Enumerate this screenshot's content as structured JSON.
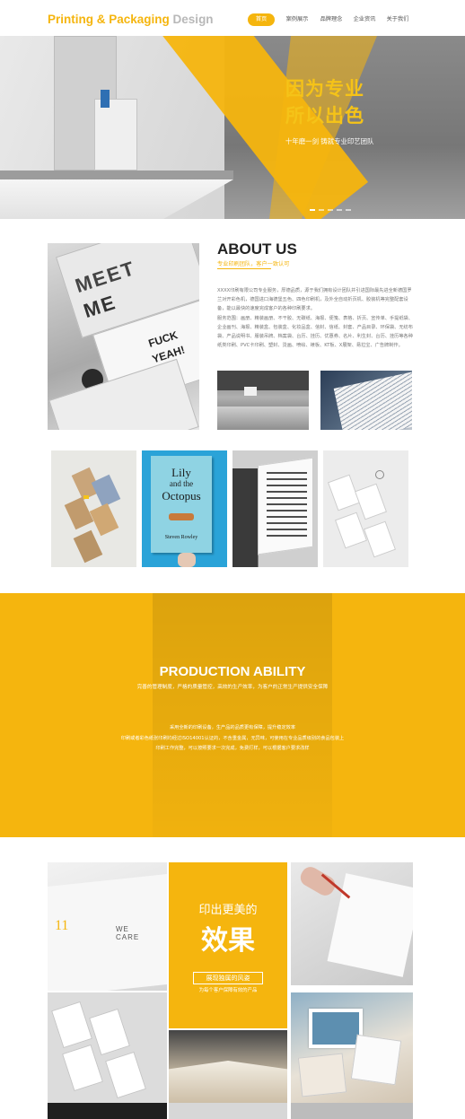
{
  "brand": {
    "part1": "Printing & Packaging",
    "part2": "Design",
    "accent": "#f5b50e",
    "muted": "#b8b8b8"
  },
  "nav": {
    "items": [
      {
        "label": "首页",
        "active": true
      },
      {
        "label": "案例展示",
        "active": false
      },
      {
        "label": "品牌理念",
        "active": false
      },
      {
        "label": "企业资讯",
        "active": false
      },
      {
        "label": "关于我们",
        "active": false
      }
    ]
  },
  "hero": {
    "title_line1": "因为专业",
    "title_line2": "所以出色",
    "subtitle": "十年磨一剑 铸就专业印艺团队"
  },
  "about": {
    "title": "ABOUT US",
    "subtitle": "专业印刷团队，客户一致认可",
    "paragraph1": "XXXX印刷有限公司专业服务，厚德品质，源于我们拥有设计团队并引进国际最先进全新德国罗兰对开彩色机，德国进口海德堡五色、四色印刷机，及外全自动折页机、胶装机等完整配套设备，能以最快的速度完成客户的各种印刷要求。",
    "paragraph2": "服务范围：画册、精装画册、不干胶、无碳纸、海报、便笺、表格、折页、宣传单、手提纸袋、企业画刊、海报、精装盒、包装盒、化妆品盒、信封、信纸、封套、产品目录、环保袋、无纺布袋、产品说明书、服装吊牌、档案袋、台历、挂历、优惠券、名片、利生封、台历、挂历等各种纸类印刷、PVC卡印刷、塑封、烫画、喷绘、裱板、KT板、X展架、易拉宝、广告牌制作。",
    "card_text1": "FUCK",
    "card_text2": "YEAH!"
  },
  "gallery": {
    "book_title_1": "Lily",
    "book_title_2": "and the",
    "book_title_3": "Octopus",
    "book_author": "Steven Rowley"
  },
  "production": {
    "title": "PRODUCTION ABILITY",
    "subtitle": "完善的管理制度，严格的质量管控，高效的生产效率，为客户的正常生产提供安全保障",
    "lines": [
      "采用全新的印刷设备，生产品的品质更有保障，提升稳定效率",
      "印刷或者彩色纸张印刷均经过ISO14001认证的，不含重金属，无异味，可使用在专业品质级别的食品包装上",
      "印刷工作完整，可以按照要求一次完成，免费打样，可以根据客户要求改样"
    ]
  },
  "effect": {
    "line1": "印出更美的",
    "line2": "效果",
    "box_label": "展现独属的风姿",
    "small": "为每个客户保障有效的产品",
    "book_page_text": "WE CARE",
    "book_page_num": "11"
  }
}
